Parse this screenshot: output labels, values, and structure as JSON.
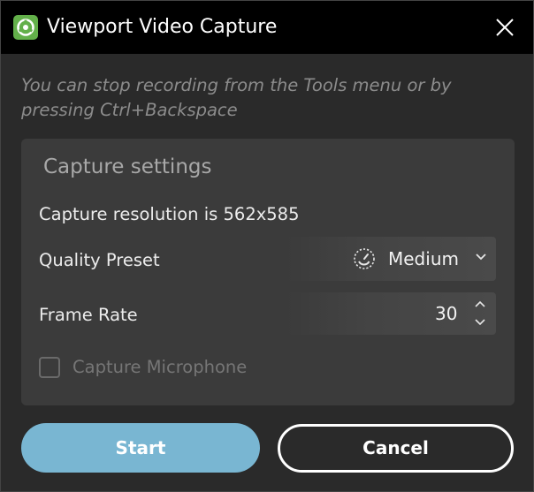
{
  "window": {
    "title": "Viewport Video Capture",
    "icon": "app-logo-icon",
    "close_icon": "close-icon"
  },
  "hint": "You can stop recording from the Tools menu or by pressing Ctrl+Backspace",
  "settings": {
    "title": "Capture settings",
    "resolution_text": "Capture resolution is 562x585",
    "quality": {
      "label": "Quality Preset",
      "value": "Medium",
      "icon": "quality-dial-icon"
    },
    "frame_rate": {
      "label": "Frame Rate",
      "value": "30"
    },
    "microphone": {
      "label": "Capture Microphone",
      "checked": false
    }
  },
  "buttons": {
    "start_label": "Start",
    "cancel_label": "Cancel"
  },
  "colors": {
    "titlebar": "#000000",
    "panel": "#3b3b3b",
    "start": "#79b6d2",
    "hint": "#8c8c8c"
  }
}
